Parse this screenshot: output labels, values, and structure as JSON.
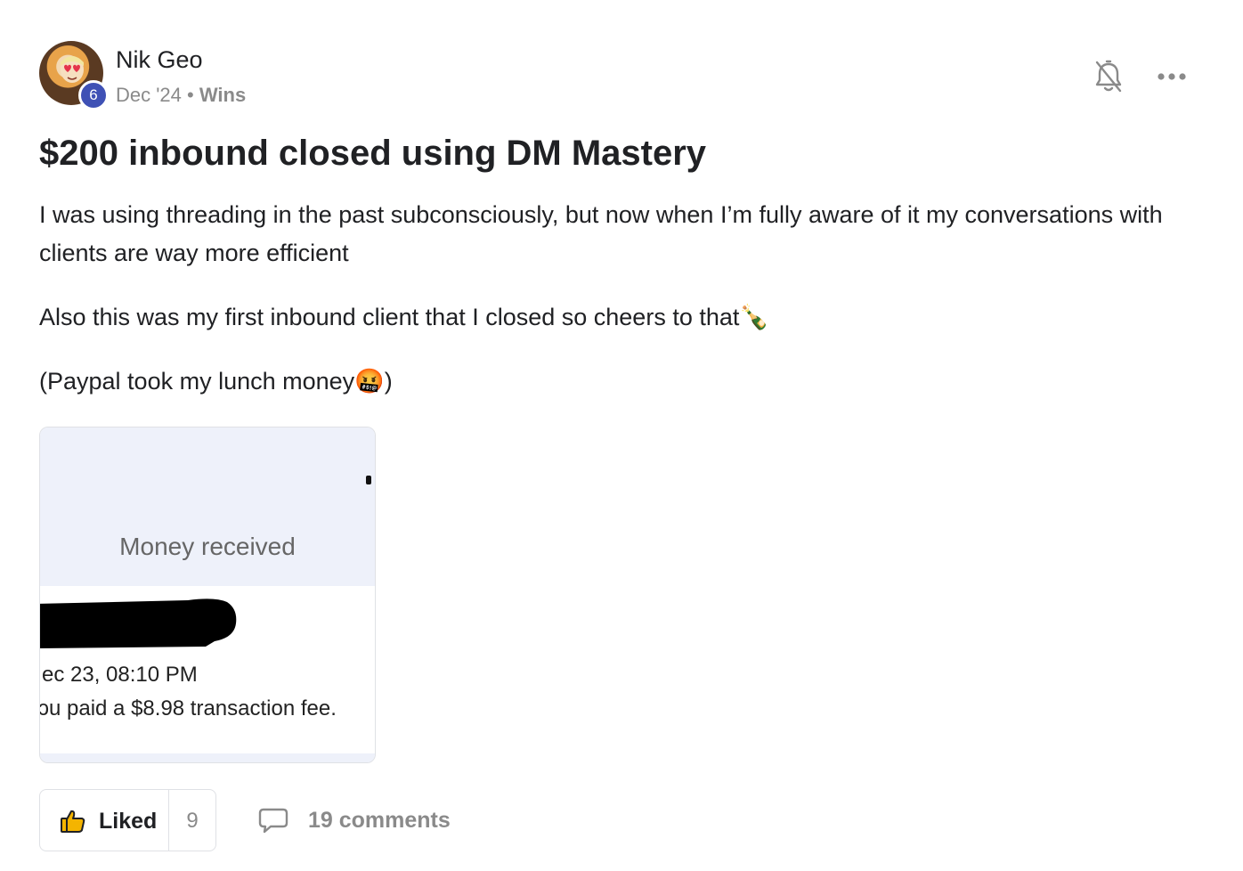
{
  "author": {
    "name": "Nik Geo",
    "level": "6",
    "date": "Dec '24",
    "separator": "•",
    "category": "Wins"
  },
  "post": {
    "title": "$200 inbound closed using DM Mastery",
    "paragraphs": [
      "I was using threading in the past subconsciously, but now when I’m fully aware of it my conversations with clients are way more efficient",
      "Also this was my first inbound client that I closed so cheers to that🍾",
      "(Paypal took my lunch money🤬)"
    ]
  },
  "attachment": {
    "heading": "Money received",
    "date_text": "ec 23, 08:10 PM",
    "fee_text": "ɔu paid a $8.98 transaction fee."
  },
  "actions": {
    "like_label": "Liked",
    "like_count": "9",
    "comments_label": "19 comments"
  },
  "icons": {
    "bell": "bell-off-icon",
    "more": "more-horizontal-icon",
    "like": "thumbs-up-icon",
    "comment": "comment-bubble-icon"
  },
  "colors": {
    "level_badge": "#3f51b5",
    "text": "#202124",
    "muted": "#8a8a8a",
    "attachment_header_bg": "#eef1fa"
  }
}
